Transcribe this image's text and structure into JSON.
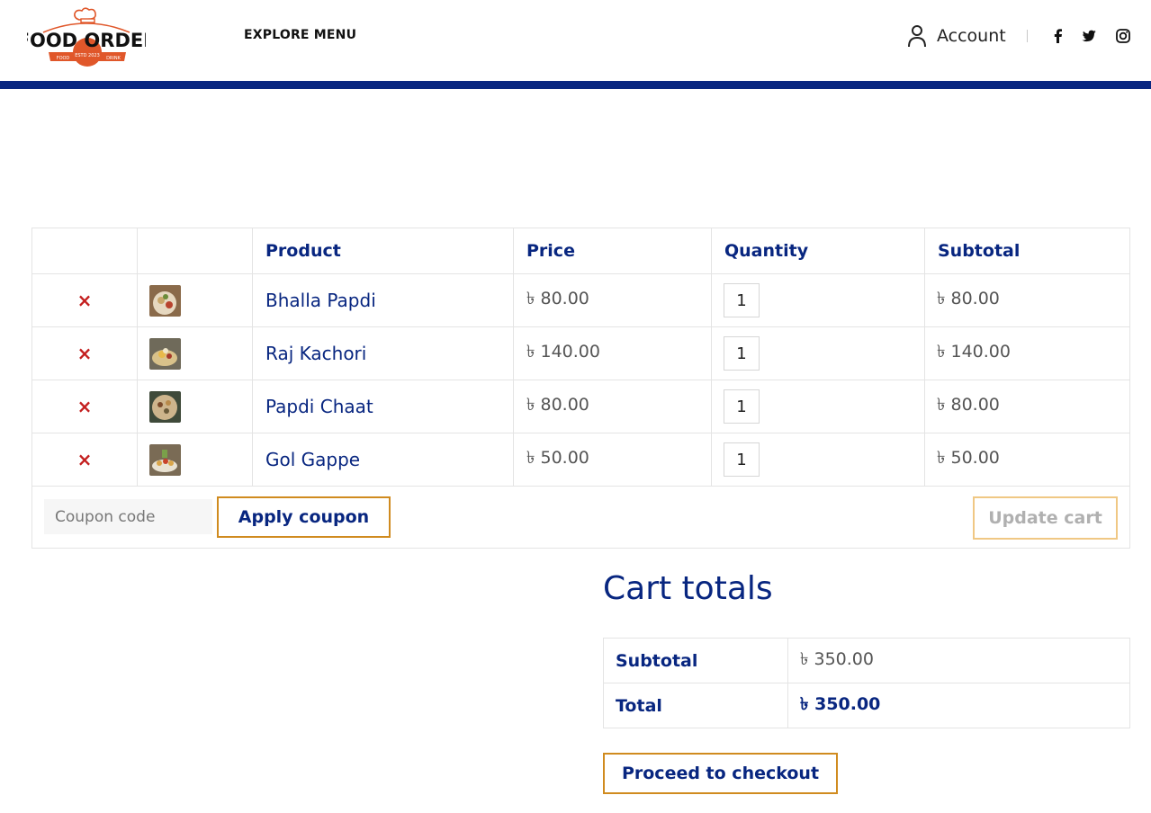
{
  "brand": {
    "logo_text": "FOOD ORDER",
    "logo_badge": "ESTD 2023",
    "logo_ribbon_left": "FOOD",
    "logo_ribbon_right": "DRINK"
  },
  "nav": {
    "explore_menu": "EXPLORE MENU",
    "account_label": "Account"
  },
  "colors": {
    "primary_navy": "#082680",
    "accent_orange": "#d08b1f",
    "remove_red": "#c41f1f"
  },
  "cart": {
    "headers": {
      "product": "Product",
      "price": "Price",
      "quantity": "Quantity",
      "subtotal": "Subtotal"
    },
    "items": [
      {
        "name": "Bhalla Papdi",
        "price": "৳ 80.00",
        "qty": "1",
        "subtotal": "৳ 80.00",
        "remove": "×"
      },
      {
        "name": "Raj Kachori",
        "price": "৳ 140.00",
        "qty": "1",
        "subtotal": "৳ 140.00",
        "remove": "×"
      },
      {
        "name": "Papdi Chaat",
        "price": "৳ 80.00",
        "qty": "1",
        "subtotal": "৳ 80.00",
        "remove": "×"
      },
      {
        "name": "Gol Gappe",
        "price": "৳ 50.00",
        "qty": "1",
        "subtotal": "৳ 50.00",
        "remove": "×"
      }
    ],
    "coupon_placeholder": "Coupon code",
    "apply_coupon": "Apply coupon",
    "update_cart": "Update cart"
  },
  "totals": {
    "title": "Cart totals",
    "subtotal_label": "Subtotal",
    "subtotal_value": "৳ 350.00",
    "total_label": "Total",
    "total_value": "৳ 350.00",
    "checkout": "Proceed to checkout"
  }
}
